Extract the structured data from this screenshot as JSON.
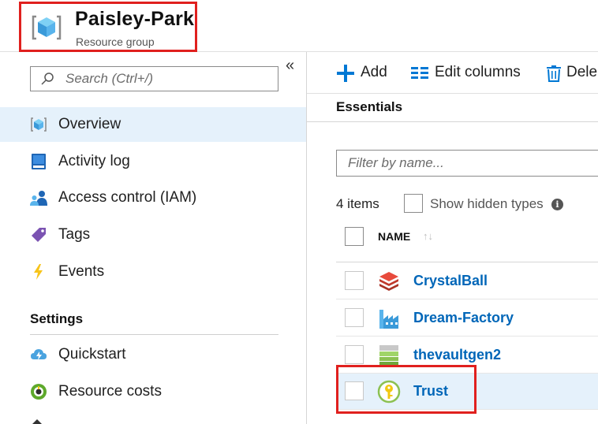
{
  "header": {
    "title": "Paisley-Park",
    "subtitle": "Resource group",
    "icon": "resource-group-cube-icon",
    "highlight_color": "#e0201e"
  },
  "sidebar": {
    "collapse_icon": "double-chevron-left-icon",
    "collapse_label": "«",
    "search": {
      "placeholder": "Search (Ctrl+/)",
      "value": ""
    },
    "items": [
      {
        "label": "Overview",
        "icon": "cube-icon",
        "selected": true
      },
      {
        "label": "Activity log",
        "icon": "book-icon",
        "selected": false
      },
      {
        "label": "Access control (IAM)",
        "icon": "people-icon",
        "selected": false
      },
      {
        "label": "Tags",
        "icon": "tag-icon",
        "selected": false
      },
      {
        "label": "Events",
        "icon": "lightning-icon",
        "selected": false
      }
    ],
    "settings_title": "Settings",
    "settings_items": [
      {
        "label": "Quickstart",
        "icon": "cloud-bolt-icon"
      },
      {
        "label": "Resource costs",
        "icon": "cost-circle-icon"
      }
    ]
  },
  "toolbar": {
    "add_label": "Add",
    "edit_columns_label": "Edit columns",
    "delete_label": "Dele"
  },
  "essentials_label": "Essentials",
  "filter": {
    "placeholder": "Filter by name...",
    "value": ""
  },
  "items_count": "4 items",
  "show_hidden_label": "Show hidden types",
  "info_glyph": "i",
  "table": {
    "column_name": "NAME",
    "sort_glyph": "↑↓",
    "rows": [
      {
        "name": "CrystalBall",
        "icon": "sql-stack-icon",
        "selected": false
      },
      {
        "name": "Dream-Factory",
        "icon": "data-factory-icon",
        "selected": false
      },
      {
        "name": "thevaultgen2",
        "icon": "storage-account-icon",
        "selected": false
      },
      {
        "name": "Trust",
        "icon": "key-vault-icon",
        "selected": true
      }
    ]
  },
  "colors": {
    "selected_bg": "#e5f1fb",
    "link": "#0066b8",
    "accent": "#0078d4"
  }
}
